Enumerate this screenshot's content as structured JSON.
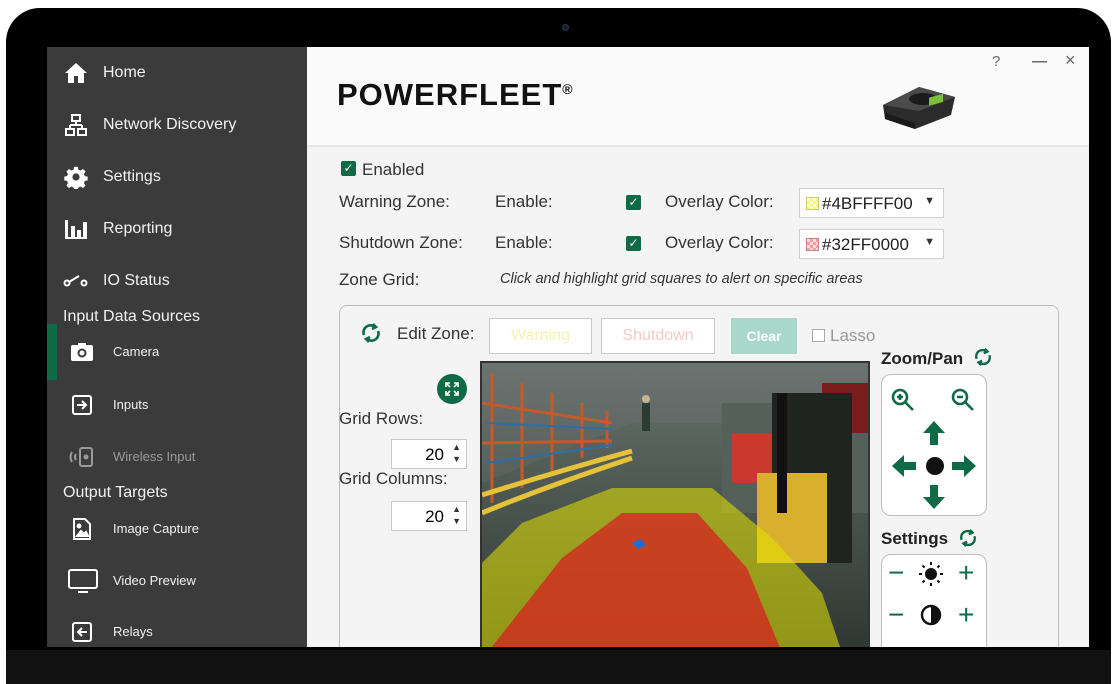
{
  "sidebar": {
    "nav": [
      {
        "label": "Home",
        "icon": "home-icon"
      },
      {
        "label": "Network Discovery",
        "icon": "network-icon"
      },
      {
        "label": "Settings",
        "icon": "gear-icon"
      },
      {
        "label": "Reporting",
        "icon": "bar-chart-icon"
      },
      {
        "label": "IO Status",
        "icon": "switch-icon"
      }
    ],
    "input_section": "Input Data Sources",
    "inputs": [
      {
        "label": "Camera",
        "icon": "camera-icon"
      },
      {
        "label": "Inputs",
        "icon": "input-arrow-icon"
      },
      {
        "label": "Wireless Input",
        "icon": "wireless-icon"
      }
    ],
    "output_section": "Output Targets",
    "outputs": [
      {
        "label": "Image Capture",
        "icon": "image-icon"
      },
      {
        "label": "Video Preview",
        "icon": "monitor-icon"
      },
      {
        "label": "Relays",
        "icon": "relay-arrow-icon"
      }
    ]
  },
  "header": {
    "logo": "POWERFLEET",
    "logo_mark": "®",
    "help": "?",
    "minimize": "—",
    "close": "×"
  },
  "settings": {
    "enabled_label": "Enabled",
    "warning_label": "Warning Zone:",
    "shutdown_label": "Shutdown Zone:",
    "enable_label": "Enable:",
    "overlay_label": "Overlay Color:",
    "warning_color": "#4BFFFF00",
    "shutdown_color": "#32FF0000",
    "zone_grid_label": "Zone Grid:",
    "zone_grid_hint": "Click and highlight grid squares to alert on specific areas"
  },
  "panel": {
    "edit_zone_label": "Edit Zone:",
    "warning_btn": "Warning",
    "shutdown_btn": "Shutdown",
    "clear_btn": "Clear",
    "lasso_label": "Lasso",
    "grid_rows_label": "Grid Rows:",
    "grid_rows_value": "20",
    "grid_cols_label": "Grid Columns:",
    "grid_cols_value": "20",
    "zoom_pan_label": "Zoom/Pan",
    "settings_label": "Settings"
  },
  "colors": {
    "accent": "#0f6a47",
    "sidebar_bg": "#3b3b3b",
    "warning_overlay": "#e6e600",
    "shutdown_overlay": "#d62020"
  }
}
